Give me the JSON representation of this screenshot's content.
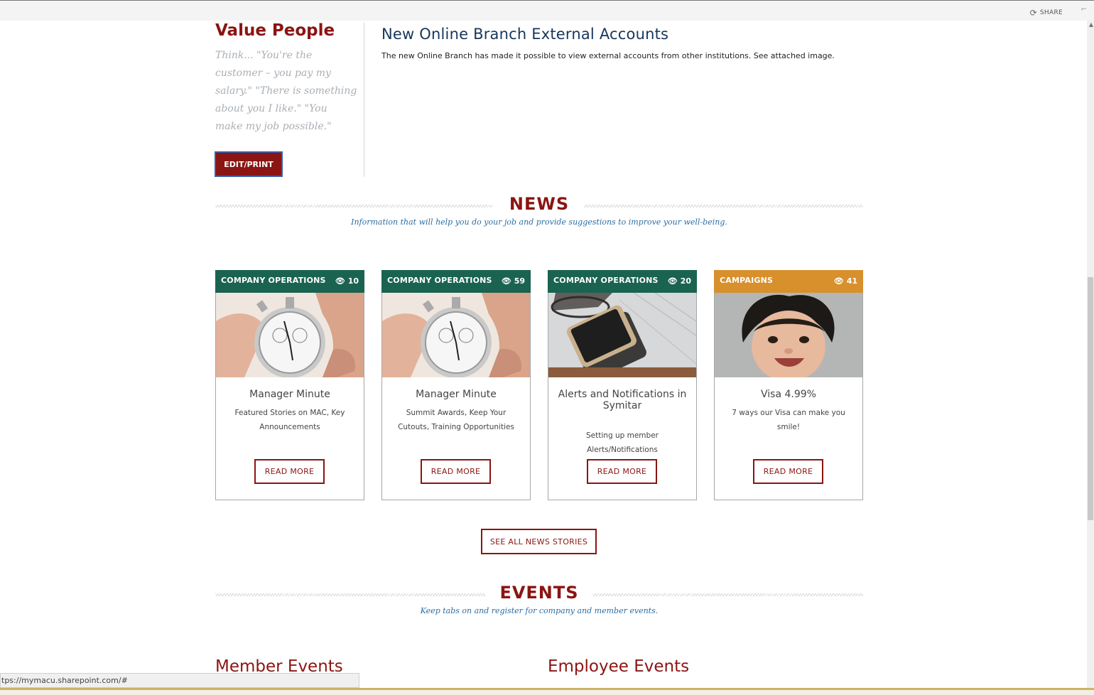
{
  "topbar": {
    "share_label": "SHARE"
  },
  "value_people": {
    "title": "Value People",
    "quote": "Think... \"You're the customer – you pay my salary.\" \"There is something about you I like.\" \"You make my job possible.\"",
    "button_label": "EDIT/PRINT"
  },
  "article": {
    "title": "New Online Branch External Accounts",
    "body": "The new Online Branch has made it possible to view external accounts from other institutions. See attached image."
  },
  "news": {
    "title": "NEWS",
    "subtitle": "Information that will help you do your job and provide suggestions to improve your well-being.",
    "see_all_label": "SEE ALL NEWS STORIES",
    "cards": [
      {
        "category": "COMPANY OPERATIONS",
        "views": "10",
        "title": "Manager Minute",
        "description": "Featured Stories on MAC, Key Announcements",
        "button": "READ MORE",
        "image": "stopwatch-image",
        "color": "#1a6350"
      },
      {
        "category": "COMPANY OPERATIONS",
        "views": "59",
        "title": "Manager Minute",
        "description": "Summit Awards, Keep Your Cutouts, Training Opportunities",
        "button": "READ MORE",
        "image": "stopwatch-image",
        "color": "#1a6350"
      },
      {
        "category": "COMPANY OPERATIONS",
        "views": "20",
        "title": "Alerts and Notifications in Symitar",
        "description": "Setting up member Alerts/Notifications",
        "button": "READ MORE",
        "image": "smartphone-image",
        "color": "#1a6350"
      },
      {
        "category": "CAMPAIGNS",
        "views": "41",
        "title": "Visa 4.99%",
        "description": "7 ways our Visa can make you smile!",
        "button": "READ MORE",
        "image": "baby-image",
        "color": "#d7902c"
      }
    ]
  },
  "events": {
    "title": "EVENTS",
    "subtitle": "Keep tabs on and register for company and member events.",
    "member_title": "Member Events",
    "employee_title": "Employee Events"
  },
  "status": {
    "url": "tps://mymacu.sharepoint.com/#"
  }
}
